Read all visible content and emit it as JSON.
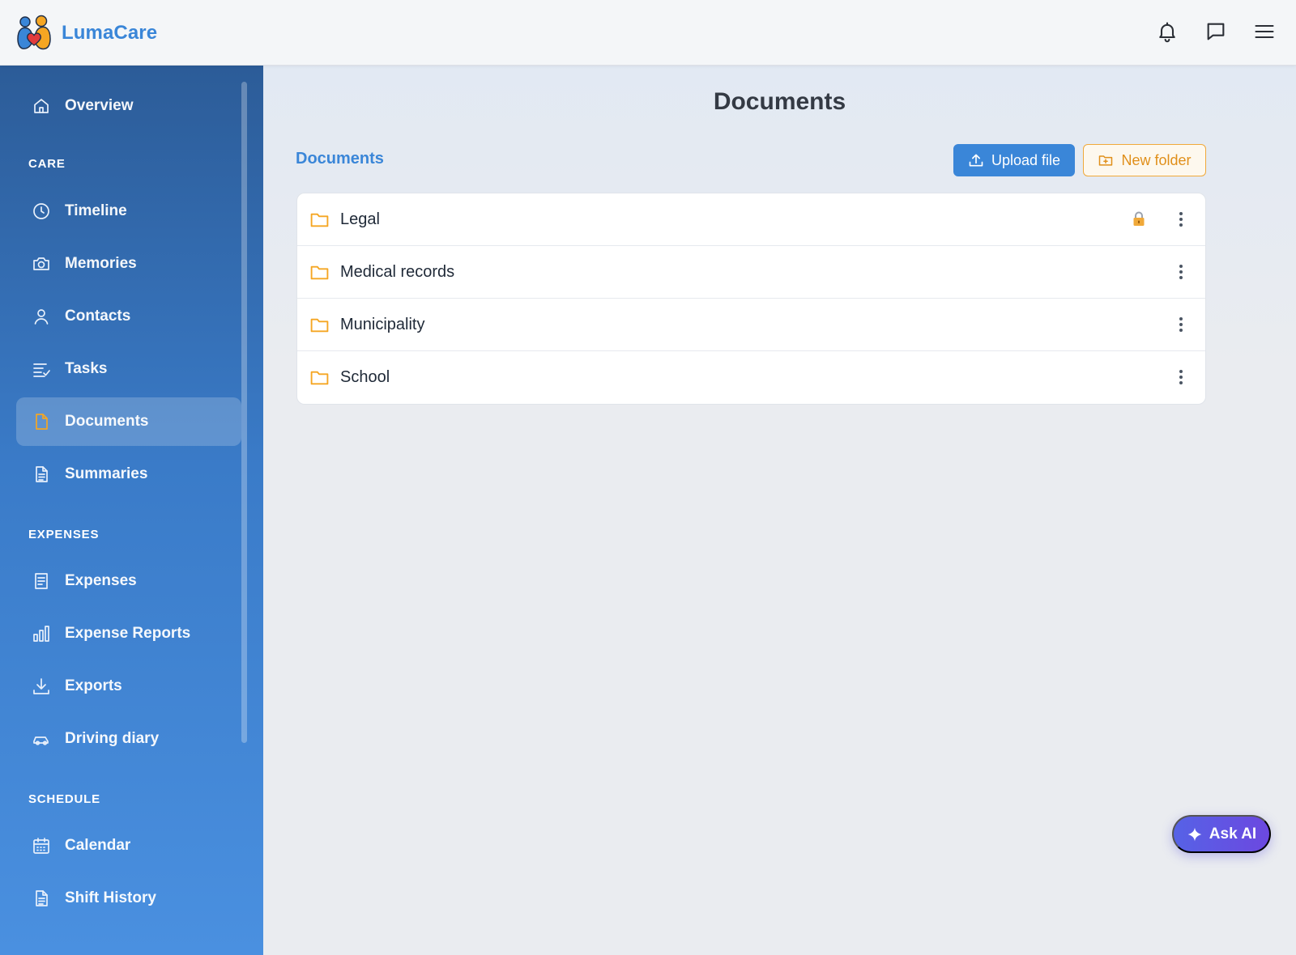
{
  "app": {
    "name": "LumaCare"
  },
  "header": {
    "icons": [
      "bell-icon",
      "chat-icon",
      "menu-icon"
    ]
  },
  "sidebar": {
    "items": [
      {
        "label": "Overview",
        "icon": "home-icon"
      },
      {
        "label": "Timeline",
        "icon": "clock-icon"
      },
      {
        "label": "Memories",
        "icon": "camera-icon"
      },
      {
        "label": "Contacts",
        "icon": "user-icon"
      },
      {
        "label": "Tasks",
        "icon": "task-list-icon"
      },
      {
        "label": "Documents",
        "icon": "document-icon",
        "active": true
      },
      {
        "label": "Summaries",
        "icon": "file-text-icon"
      },
      {
        "label": "Expenses",
        "icon": "receipt-icon"
      },
      {
        "label": "Expense Reports",
        "icon": "bar-chart-icon"
      },
      {
        "label": "Exports",
        "icon": "download-icon"
      },
      {
        "label": "Driving diary",
        "icon": "car-icon"
      },
      {
        "label": "Calendar",
        "icon": "calendar-icon"
      },
      {
        "label": "Shift History",
        "icon": "file-lines-icon"
      }
    ],
    "sections": {
      "care": "CARE",
      "expenses": "EXPENSES",
      "schedule": "SCHEDULE"
    }
  },
  "main": {
    "title": "Documents",
    "breadcrumb": "Documents",
    "upload_label": "Upload file",
    "new_folder_label": "New folder",
    "folders": [
      {
        "name": "Legal",
        "locked": true
      },
      {
        "name": "Medical records",
        "locked": false
      },
      {
        "name": "Municipality",
        "locked": false
      },
      {
        "name": "School",
        "locked": false
      }
    ]
  },
  "ask_ai": {
    "label": "Ask AI"
  },
  "colors": {
    "brand": "#3a86d8",
    "accent": "#f5a623",
    "ai": "#5662e6"
  }
}
